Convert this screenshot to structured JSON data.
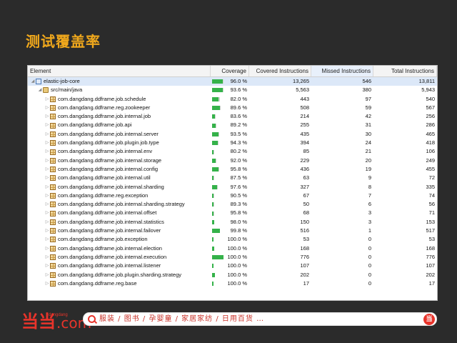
{
  "slide": {
    "title": "测试覆盖率"
  },
  "colors": {
    "accent": "#f0a81c",
    "coverage_bar": "#35b24a",
    "brand_red": "#e8342b"
  },
  "table": {
    "headers": {
      "element": "Element",
      "coverage": "Coverage",
      "covered": "Covered Instructions",
      "missed": "Missed Instructions",
      "total": "Total Instructions"
    },
    "sorted_column": "missed",
    "rows": [
      {
        "level": 0,
        "icon": "project-icon",
        "name": "elastic-job-core",
        "coverage": "96.0 %",
        "cov_pct": 96.0,
        "covered": "13,265",
        "missed": "546",
        "total": "13,811",
        "selected": true
      },
      {
        "level": 1,
        "icon": "source-folder-icon",
        "name": "src/main/java",
        "coverage": "93.6 %",
        "cov_pct": 93.6,
        "covered": "5,563",
        "missed": "380",
        "total": "5,943"
      },
      {
        "level": 2,
        "icon": "package-icon",
        "name": "com.dangdang.ddframe.job.schedule",
        "coverage": "82.0 %",
        "cov_pct": 82.0,
        "covered": "443",
        "missed": "97",
        "total": "540"
      },
      {
        "level": 2,
        "icon": "package-icon",
        "name": "com.dangdang.ddframe.reg.zookeeper",
        "coverage": "89.6 %",
        "cov_pct": 89.6,
        "covered": "508",
        "missed": "59",
        "total": "567"
      },
      {
        "level": 2,
        "icon": "package-icon",
        "name": "com.dangdang.ddframe.job.internal.job",
        "coverage": "83.6 %",
        "cov_pct": 83.6,
        "covered": "214",
        "missed": "42",
        "total": "256"
      },
      {
        "level": 2,
        "icon": "package-icon",
        "name": "com.dangdang.ddframe.job.api",
        "coverage": "89.2 %",
        "cov_pct": 89.2,
        "covered": "255",
        "missed": "31",
        "total": "286"
      },
      {
        "level": 2,
        "icon": "package-icon",
        "name": "com.dangdang.ddframe.job.internal.server",
        "coverage": "93.5 %",
        "cov_pct": 93.5,
        "covered": "435",
        "missed": "30",
        "total": "465"
      },
      {
        "level": 2,
        "icon": "package-icon",
        "name": "com.dangdang.ddframe.job.plugin.job.type",
        "coverage": "94.3 %",
        "cov_pct": 94.3,
        "covered": "394",
        "missed": "24",
        "total": "418"
      },
      {
        "level": 2,
        "icon": "package-icon",
        "name": "com.dangdang.ddframe.job.internal.env",
        "coverage": "80.2 %",
        "cov_pct": 80.2,
        "covered": "85",
        "missed": "21",
        "total": "106"
      },
      {
        "level": 2,
        "icon": "package-icon",
        "name": "com.dangdang.ddframe.job.internal.storage",
        "coverage": "92.0 %",
        "cov_pct": 92.0,
        "covered": "229",
        "missed": "20",
        "total": "249"
      },
      {
        "level": 2,
        "icon": "package-icon",
        "name": "com.dangdang.ddframe.job.internal.config",
        "coverage": "95.8 %",
        "cov_pct": 95.8,
        "covered": "436",
        "missed": "19",
        "total": "455"
      },
      {
        "level": 2,
        "icon": "package-icon",
        "name": "com.dangdang.ddframe.job.internal.util",
        "coverage": "87.5 %",
        "cov_pct": 87.5,
        "covered": "63",
        "missed": "9",
        "total": "72"
      },
      {
        "level": 2,
        "icon": "package-icon",
        "name": "com.dangdang.ddframe.job.internal.sharding",
        "coverage": "97.6 %",
        "cov_pct": 97.6,
        "covered": "327",
        "missed": "8",
        "total": "335"
      },
      {
        "level": 2,
        "icon": "package-icon",
        "name": "com.dangdang.ddframe.reg.exception",
        "coverage": "90.5 %",
        "cov_pct": 90.5,
        "covered": "67",
        "missed": "7",
        "total": "74"
      },
      {
        "level": 2,
        "icon": "package-icon",
        "name": "com.dangdang.ddframe.job.internal.sharding.strategy",
        "coverage": "89.3 %",
        "cov_pct": 89.3,
        "covered": "50",
        "missed": "6",
        "total": "56"
      },
      {
        "level": 2,
        "icon": "package-icon",
        "name": "com.dangdang.ddframe.job.internal.offset",
        "coverage": "95.8 %",
        "cov_pct": 95.8,
        "covered": "68",
        "missed": "3",
        "total": "71"
      },
      {
        "level": 2,
        "icon": "package-icon",
        "name": "com.dangdang.ddframe.job.internal.statistics",
        "coverage": "98.0 %",
        "cov_pct": 98.0,
        "covered": "150",
        "missed": "3",
        "total": "153"
      },
      {
        "level": 2,
        "icon": "package-icon",
        "name": "com.dangdang.ddframe.job.internal.failover",
        "coverage": "99.8 %",
        "cov_pct": 99.8,
        "covered": "516",
        "missed": "1",
        "total": "517"
      },
      {
        "level": 2,
        "icon": "package-icon",
        "name": "com.dangdang.ddframe.job.exception",
        "coverage": "100.0 %",
        "cov_pct": 100.0,
        "covered": "53",
        "missed": "0",
        "total": "53"
      },
      {
        "level": 2,
        "icon": "package-icon",
        "name": "com.dangdang.ddframe.job.internal.election",
        "coverage": "100.0 %",
        "cov_pct": 100.0,
        "covered": "168",
        "missed": "0",
        "total": "168"
      },
      {
        "level": 2,
        "icon": "package-icon",
        "name": "com.dangdang.ddframe.job.internal.execution",
        "coverage": "100.0 %",
        "cov_pct": 100.0,
        "covered": "776",
        "missed": "0",
        "total": "776"
      },
      {
        "level": 2,
        "icon": "package-icon",
        "name": "com.dangdang.ddframe.job.internal.listener",
        "coverage": "100.0 %",
        "cov_pct": 100.0,
        "covered": "107",
        "missed": "0",
        "total": "107"
      },
      {
        "level": 2,
        "icon": "package-icon",
        "name": "com.dangdang.ddframe.job.plugin.sharding.strategy",
        "coverage": "100.0 %",
        "cov_pct": 100.0,
        "covered": "202",
        "missed": "0",
        "total": "202"
      },
      {
        "level": 2,
        "icon": "package-icon",
        "name": "com.dangdang.ddframe.reg.base",
        "coverage": "100.0 %",
        "cov_pct": 100.0,
        "covered": "17",
        "missed": "0",
        "total": "17"
      }
    ]
  },
  "footer": {
    "logo_mark": "当当",
    "logo_com": ".com",
    "logo_sub": "dangdang",
    "search_text": "服装 / 图书 / 孕婴童 / 家居家纺 / 日用百货 …",
    "badge": "当"
  }
}
